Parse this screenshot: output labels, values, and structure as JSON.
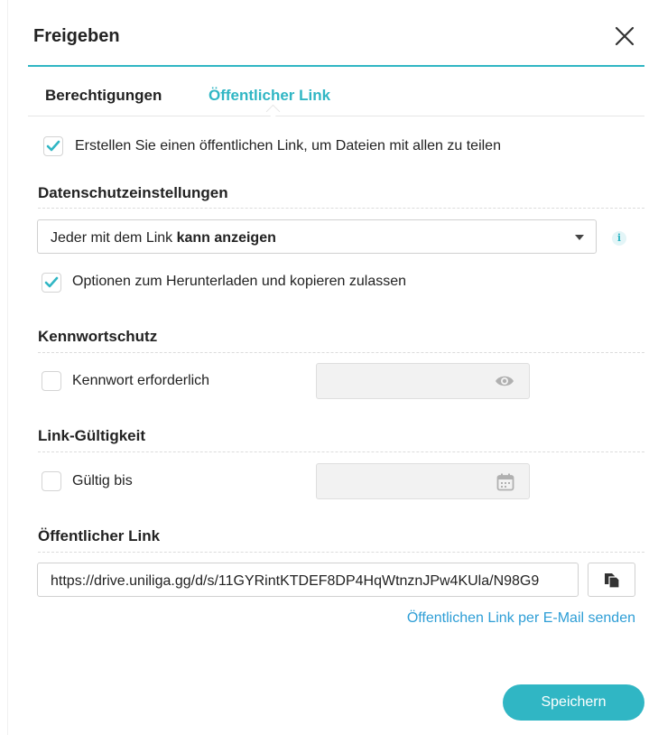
{
  "dialog": {
    "title": "Freigeben"
  },
  "tabs": [
    {
      "label": "Berechtigungen",
      "active": false
    },
    {
      "label": "Öffentlicher Link",
      "active": true
    }
  ],
  "create_public_link": {
    "label": "Erstellen Sie einen öffentlichen Link, um Dateien mit allen zu teilen",
    "checked": true
  },
  "privacy": {
    "heading": "Datenschutzeinstellungen",
    "select_prefix": "Jeder mit dem Link ",
    "select_strong": "kann anzeigen",
    "info_glyph": "i",
    "allow_download": {
      "label": "Optionen zum Herunterladen und kopieren zulassen",
      "checked": true
    }
  },
  "password": {
    "heading": "Kennwortschutz",
    "required_label": "Kennwort erforderlich",
    "checked": false,
    "value": ""
  },
  "validity": {
    "heading": "Link-Gültigkeit",
    "valid_until_label": "Gültig bis",
    "checked": false,
    "value": ""
  },
  "public_link": {
    "heading": "Öffentlicher Link",
    "url": "https://drive.uniliga.gg/d/s/11GYRintKTDEF8DP4HqWtnznJPw4KUla/N98G9",
    "email_label": "Öffentlichen Link per E-Mail senden"
  },
  "footer": {
    "save_label": "Speichern"
  },
  "colors": {
    "accent": "#30b6c4",
    "link": "#2e9ed6"
  }
}
